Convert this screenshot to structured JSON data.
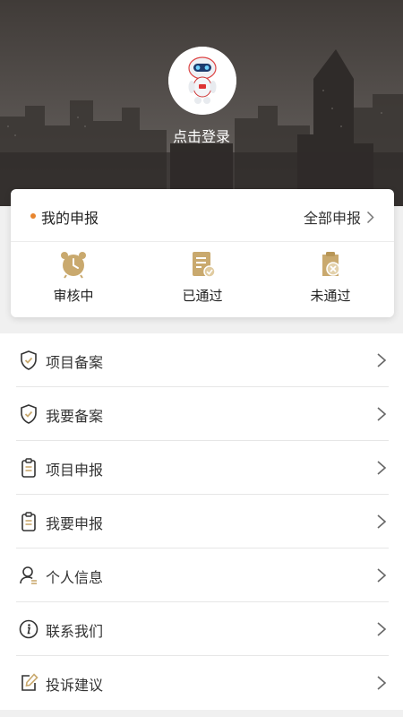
{
  "header": {
    "login_text": "点击登录",
    "avatar_icon": "robot-mascot-icon"
  },
  "declaration_card": {
    "title": "我的申报",
    "all_link": "全部申报",
    "accent_color": "#e8852e",
    "icon_color": "#c9a96e",
    "stats": [
      {
        "label": "审核中",
        "icon": "alarm-clock-icon"
      },
      {
        "label": "已通过",
        "icon": "document-approved-icon"
      },
      {
        "label": "未通过",
        "icon": "document-rejected-icon"
      }
    ]
  },
  "menu": {
    "items": [
      {
        "label": "项目备案",
        "icon": "shield-check-icon"
      },
      {
        "label": "我要备案",
        "icon": "shield-check-icon"
      },
      {
        "label": "项目申报",
        "icon": "clipboard-icon"
      },
      {
        "label": "我要申报",
        "icon": "clipboard-icon"
      },
      {
        "label": "个人信息",
        "icon": "user-icon"
      },
      {
        "label": "联系我们",
        "icon": "info-icon"
      },
      {
        "label": "投诉建议",
        "icon": "edit-icon"
      }
    ]
  }
}
